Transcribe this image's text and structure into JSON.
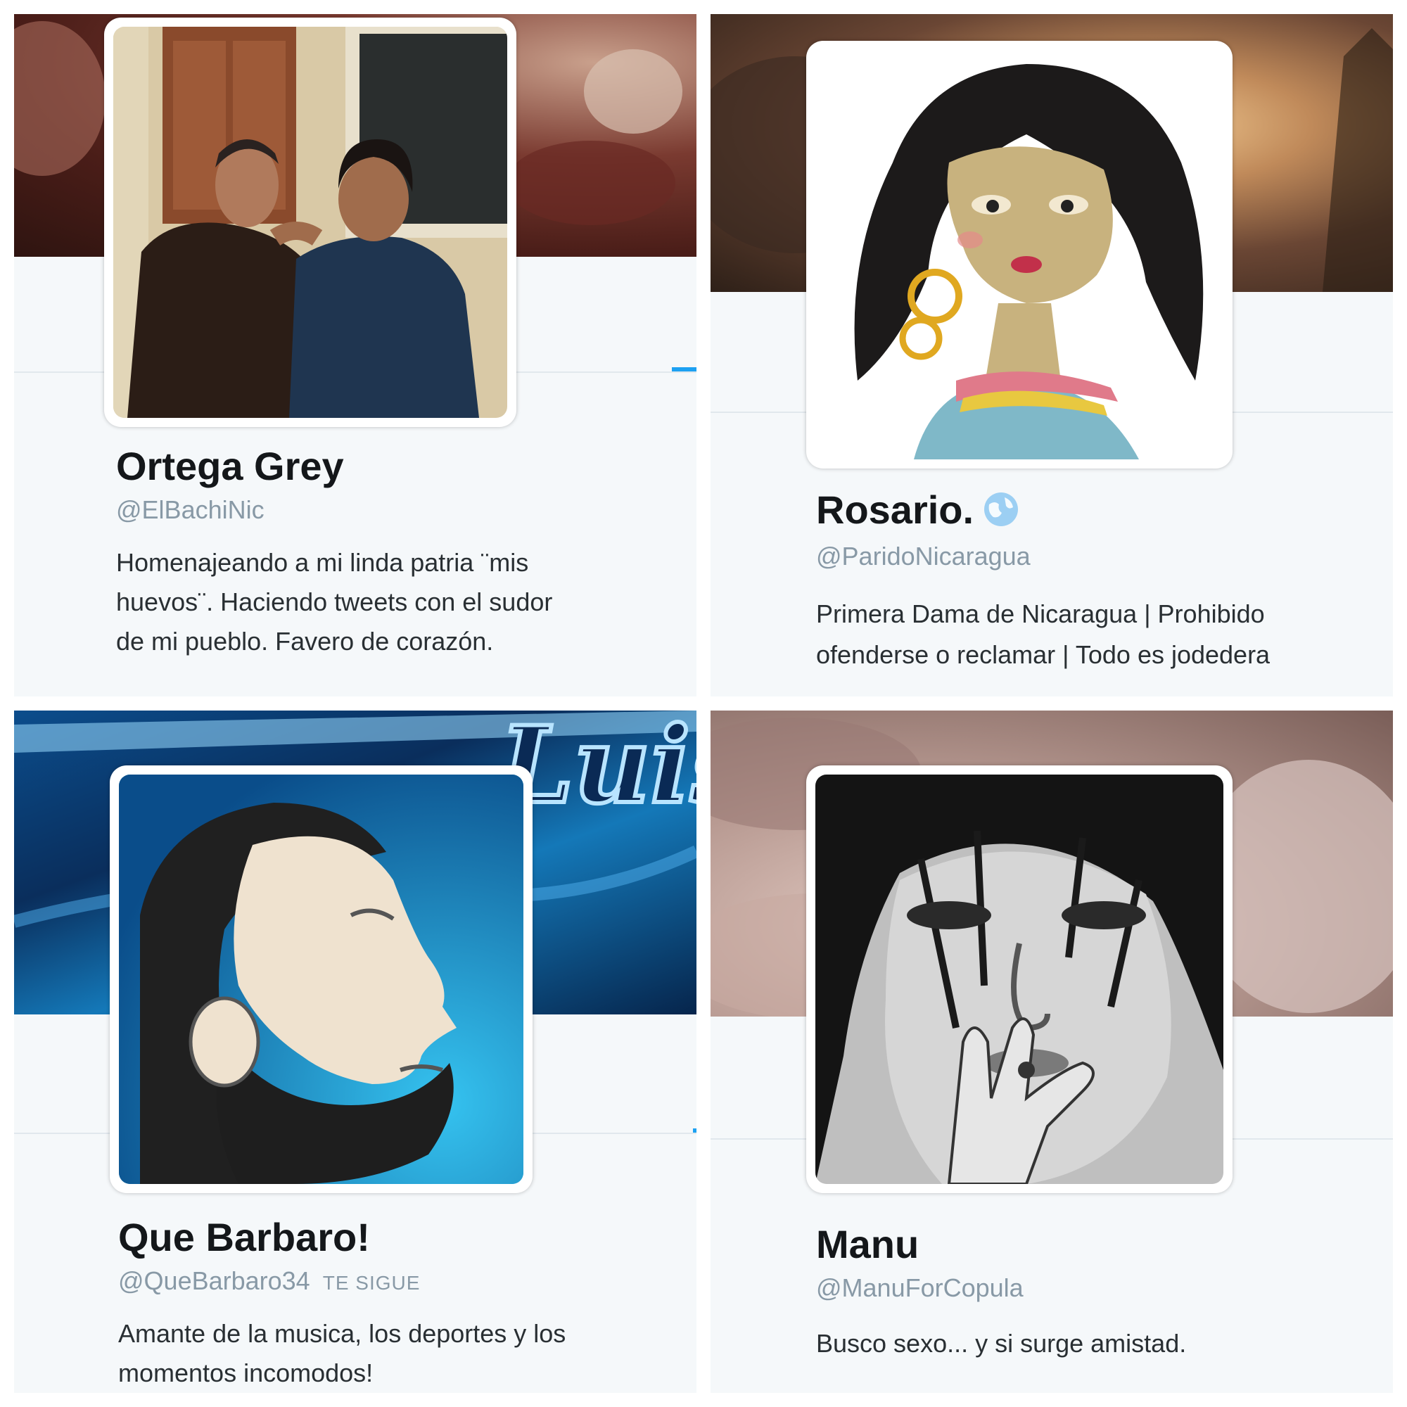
{
  "profiles": [
    {
      "name": "Ortega Grey",
      "handle": "@ElBachiNic",
      "bio_lines": [
        "Homenajeando a mi linda patria ¨mis",
        "huevos¨. Haciendo tweets con el sudor",
        "de mi pueblo. Favero de corazón."
      ],
      "banner_color": "#5a2a22",
      "avatar_icon": "photo-two-men"
    },
    {
      "name": "Rosario.",
      "handle": "@ParidoNicaragua",
      "bio_lines": [
        "Primera Dama de Nicaragua | Prohibido",
        "ofenderse o reclamar | Todo es jodedera"
      ],
      "banner_color": "#4a3226",
      "avatar_icon": "caricature-woman",
      "badge_icon": "globe-icon"
    },
    {
      "name": "Que Barbaro!",
      "handle": "@QueBarbaro34",
      "follows_label": "TE SIGUE",
      "bio_lines": [
        "Amante de la musica, los deportes y los",
        "momentos incomodos!"
      ],
      "banner_color": "#0a3f7a",
      "banner_text": "Luis",
      "avatar_icon": "bearded-profile-illustration"
    },
    {
      "name": "Manu",
      "handle": "@ManuForCopula",
      "bio_lines": [
        "Busco sexo... y si surge amistad."
      ],
      "banner_color": "#b8a6a0",
      "avatar_icon": "drawing-woman-face"
    }
  ]
}
